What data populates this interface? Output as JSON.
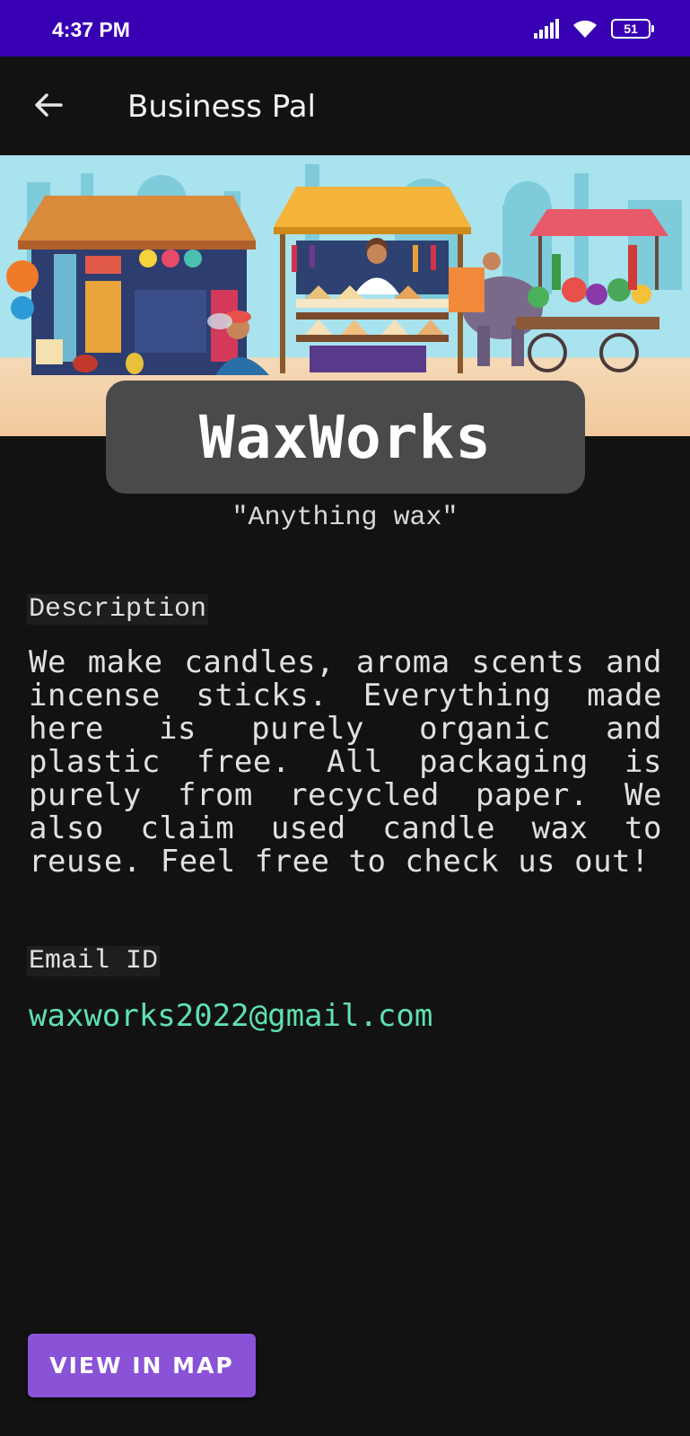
{
  "status_bar": {
    "time": "4:37 PM",
    "battery_level": "51",
    "icons": [
      "signal-icon",
      "wifi-icon",
      "battery-icon"
    ]
  },
  "app_bar": {
    "title": "Business Pal",
    "back_icon": "arrow-left-icon"
  },
  "business": {
    "name": "WaxWorks",
    "tagline": "\"Anything wax\""
  },
  "description_section": {
    "label": "Description",
    "text": "We make candles, aroma scents and incense sticks. Everything made here is purely organic and plastic free. All packaging is purely from recycled paper. We also claim used candle wax to reuse. Feel free to check us out!"
  },
  "email_section": {
    "label": "Email ID",
    "value": "waxworks2022@gmail.com"
  },
  "actions": {
    "map_button_label": "VIEW IN MAP"
  },
  "colors": {
    "status_bar": "#3700b3",
    "background": "#121212",
    "name_card": "#4a4a4a",
    "email": "#5fe0b0",
    "button": "#8a52d6"
  }
}
